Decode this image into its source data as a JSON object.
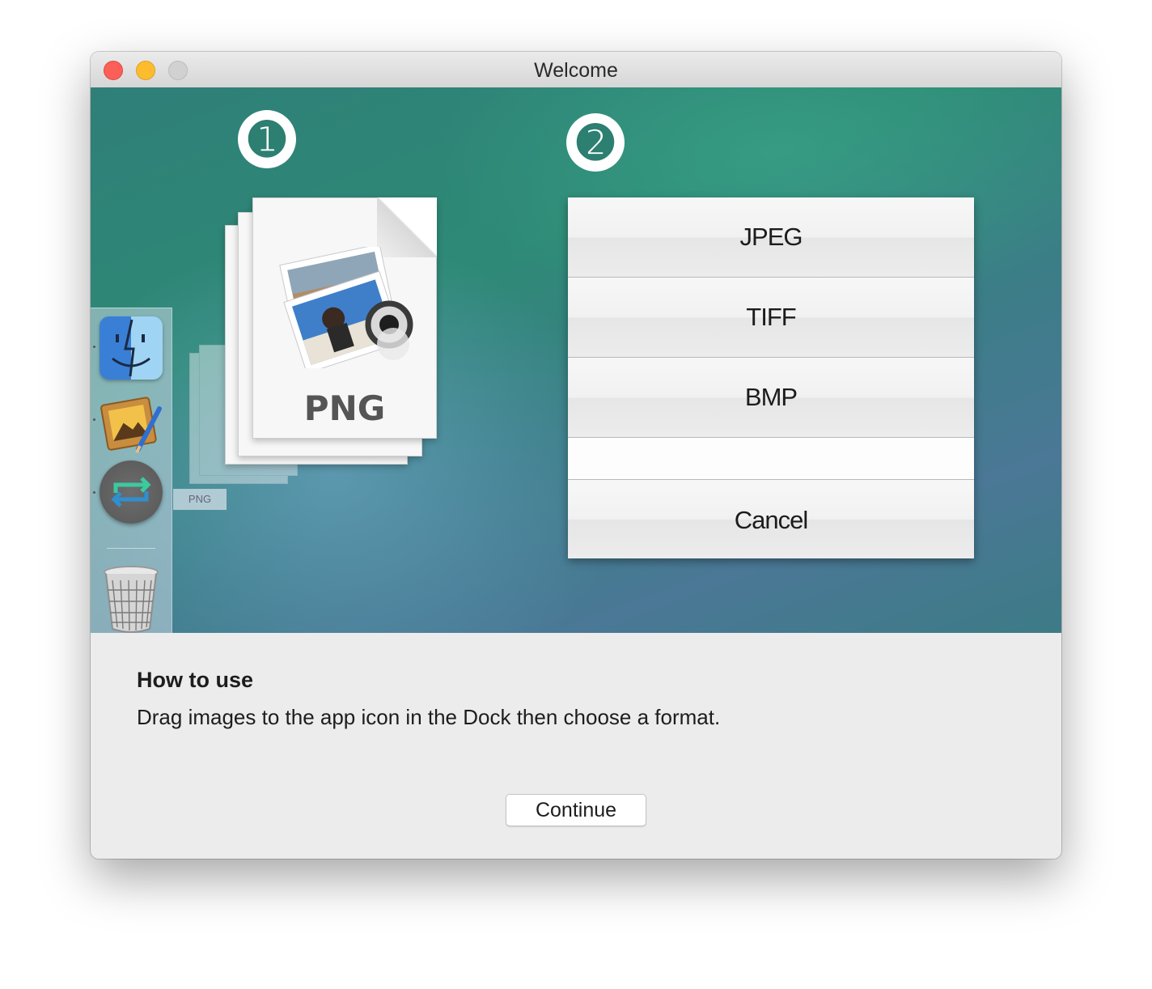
{
  "window": {
    "title": "Welcome"
  },
  "hero": {
    "step1": "➊",
    "step2": "➋",
    "file_label": "PNG",
    "ghost_label": "PNG",
    "menu": {
      "options": [
        "JPEG",
        "TIFF",
        "BMP"
      ],
      "cancel": "Cancel"
    }
  },
  "instructions": {
    "heading": "How to use",
    "text": "Drag images to the app icon in the Dock then choose a format."
  },
  "footer": {
    "continue_label": "Continue"
  }
}
